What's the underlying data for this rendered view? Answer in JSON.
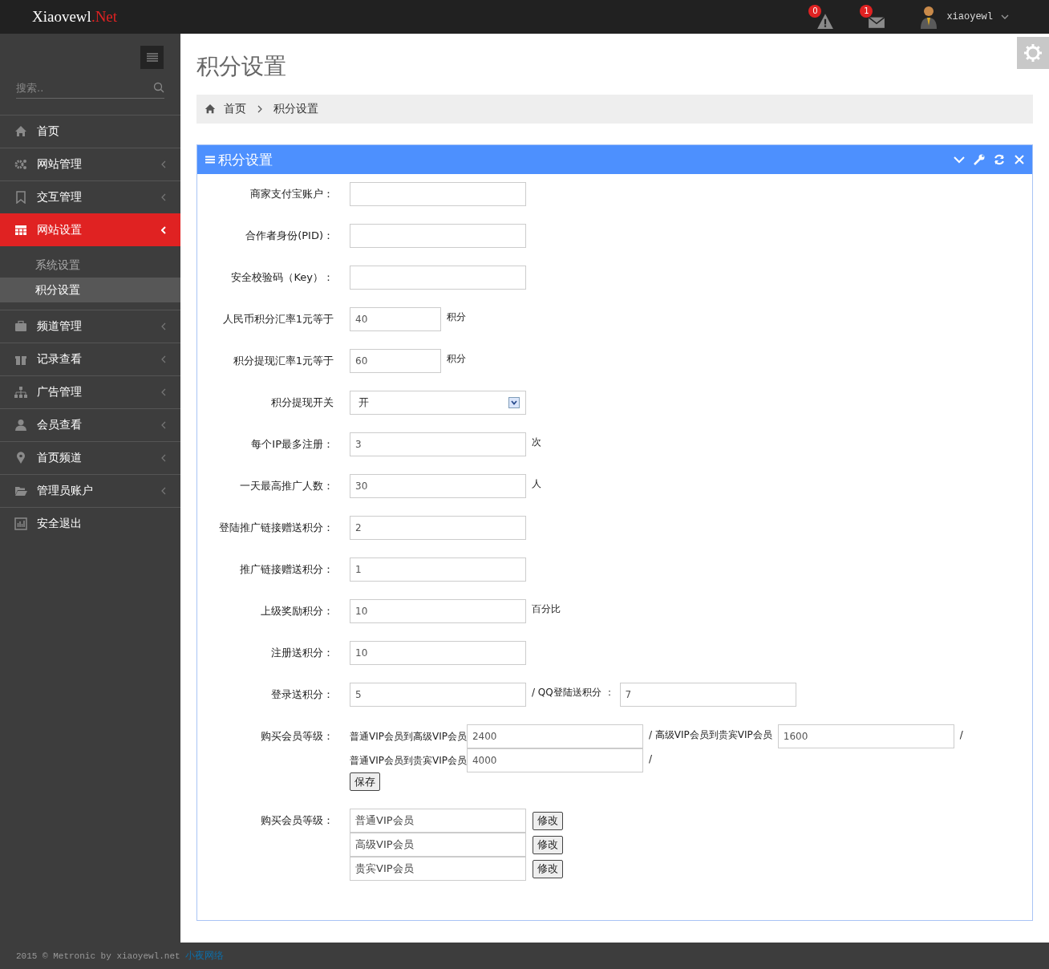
{
  "header": {
    "logo": "Xiaovewl",
    "logo_suffix": ".Net",
    "alerts": [
      {
        "count": "0"
      },
      {
        "count": "1"
      }
    ],
    "user": "xiaoyewl"
  },
  "sidebar": {
    "search_placeholder": "搜索..",
    "items": [
      {
        "label": "首页",
        "has_submenu": false,
        "selected": false
      },
      {
        "label": "网站管理",
        "has_submenu": true,
        "selected": false
      },
      {
        "label": "交互管理",
        "has_submenu": true,
        "selected": false
      },
      {
        "label": "网站设置",
        "has_submenu": true,
        "selected": true,
        "children": [
          {
            "label": "系统设置",
            "selected": false
          },
          {
            "label": "积分设置",
            "selected": true
          }
        ]
      },
      {
        "label": "频道管理",
        "has_submenu": true,
        "selected": false
      },
      {
        "label": "记录查看",
        "has_submenu": true,
        "selected": false
      },
      {
        "label": "广告管理",
        "has_submenu": true,
        "selected": false
      },
      {
        "label": "会员查看",
        "has_submenu": true,
        "selected": false
      },
      {
        "label": "首页频道",
        "has_submenu": true,
        "selected": false
      },
      {
        "label": "管理员账户",
        "has_submenu": true,
        "selected": false
      },
      {
        "label": "安全退出",
        "has_submenu": false,
        "selected": false
      }
    ]
  },
  "page_title": "积分设置",
  "breadcrumb": [
    "首页",
    "积分设置"
  ],
  "portlet": {
    "title": "积分设置",
    "fields": [
      {
        "kind": "input",
        "label": "商家支付宝账户："
      },
      {
        "kind": "input",
        "label": "合作者身份(PID)："
      },
      {
        "kind": "input",
        "label": "安全校验码（Key）："
      },
      {
        "kind": "short",
        "label": "人民币积分汇率1元等于",
        "value": "40",
        "suffix": "积分"
      },
      {
        "kind": "short",
        "label": "积分提现汇率1元等于",
        "value": "60",
        "suffix": "积分"
      },
      {
        "kind": "select",
        "label": "积分提现开关",
        "value": "开"
      },
      {
        "kind": "input",
        "label": "每个IP最多注册：",
        "value": "3",
        "suffix": "次"
      },
      {
        "kind": "input",
        "label": "一天最高推广人数：",
        "value": "30",
        "suffix": "人"
      },
      {
        "kind": "input",
        "label": "登陆推广链接赠送积分：",
        "value": "2"
      },
      {
        "kind": "input",
        "label": "推广链接赠送积分：",
        "value": "1"
      },
      {
        "kind": "input",
        "label": "上级奖励积分：",
        "value": "10",
        "suffix": "百分比"
      },
      {
        "kind": "input",
        "label": "注册送积分：",
        "value": "10"
      },
      {
        "kind": "pair",
        "label": "登录送积分：",
        "value": "5",
        "middle": "/ QQ登陆送积分 ：",
        "value2": "7"
      }
    ],
    "upgrade": {
      "label": "购买会员等级：",
      "lines": [
        [
          {
            "prefix": "普通VIP会员到高级VIP会员",
            "value": "2400",
            "suffix": "/ 高级VIP会员到贵宾VIP会员"
          },
          {
            "value": "1600",
            "suffix": "/"
          }
        ],
        [
          {
            "prefix": "普通VIP会员到贵宾VIP会员",
            "value": "4000",
            "suffix": "/"
          }
        ]
      ]
    },
    "save_button": "保存",
    "levels": {
      "label": "购买会员等级：",
      "items": [
        {
          "value": "普通VIP会员",
          "button": "修改"
        },
        {
          "value": "高级VIP会员",
          "button": "修改"
        },
        {
          "value": "贵宾VIP会员",
          "button": "修改"
        }
      ]
    }
  },
  "footer": {
    "text": "2015 © Metronic by xiaoyewl.net",
    "link": "小夜网络"
  }
}
